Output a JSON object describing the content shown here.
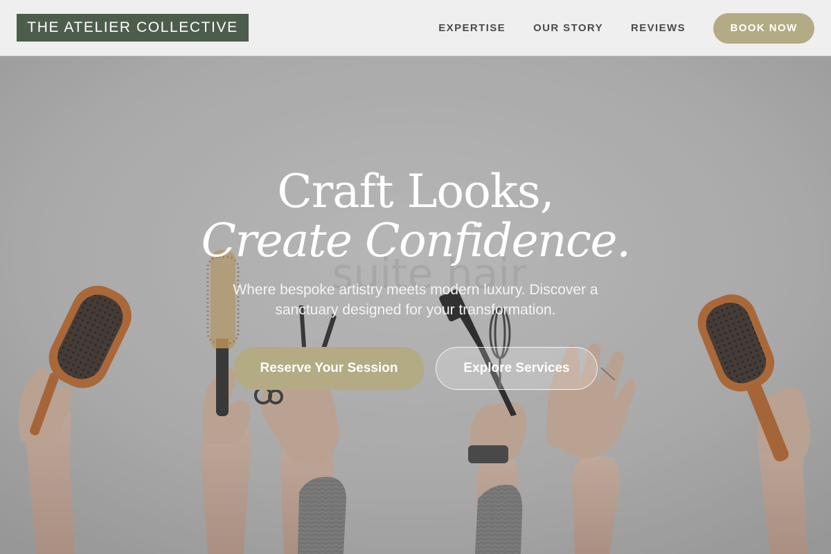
{
  "header": {
    "logo_text": "THE ATELIER COLLECTIVE",
    "nav": {
      "expertise": "EXPERTISE",
      "our_story": "OUR STORY",
      "reviews": "REVIEWS"
    },
    "book_label": "BOOK NOW"
  },
  "hero": {
    "title_line1": "Craft Looks,",
    "title_line2": "Create Confidence.",
    "subtitle": "Where bespoke artistry meets modern luxury. Discover a sanctuary designed for your transformation.",
    "primary_cta": "Reserve Your Session",
    "secondary_cta": "Explore Services",
    "background_icon": "hands-holding-hair-tools-photo"
  },
  "colors": {
    "accent": "#b3ab84",
    "logo_bg": "#4d5d4c",
    "header_bg": "#efefef",
    "nav_text": "#4a4a4a"
  }
}
